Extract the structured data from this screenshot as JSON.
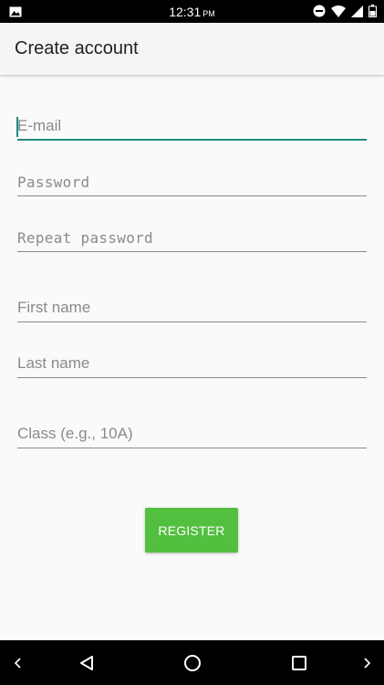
{
  "status_bar": {
    "time": "12:31",
    "ampm": "PM",
    "icons": [
      "image-icon",
      "do-not-disturb-icon",
      "wifi-icon",
      "cell-signal-icon",
      "battery-icon"
    ]
  },
  "app_bar": {
    "title": "Create account"
  },
  "form": {
    "email_placeholder": "E-mail",
    "password_placeholder": "Password",
    "repeat_password_placeholder": "Repeat password",
    "first_name_placeholder": "First name",
    "last_name_placeholder": "Last name",
    "class_placeholder": "Class (e.g., 10A)"
  },
  "register_button": {
    "label": "REGISTER"
  },
  "nav_bar": {
    "icons": [
      "left-chevron-icon",
      "back-icon",
      "home-icon",
      "recents-icon",
      "right-chevron-icon"
    ]
  },
  "colors": {
    "accent": "#1f8c7f",
    "button": "#52bf3f",
    "background": "#fafafa",
    "app_bar": "#f5f5f5"
  }
}
